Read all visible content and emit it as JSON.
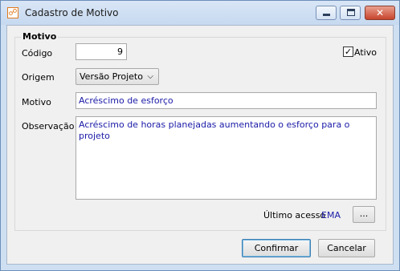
{
  "window": {
    "title": "Cadastro de Motivo",
    "controls": {
      "minimize_icon": "minimize-icon",
      "maximize_icon": "maximize-icon",
      "close_icon": "close-icon"
    }
  },
  "group": {
    "title": "Motivo"
  },
  "form": {
    "codigo_label": "Código",
    "codigo_value": "9",
    "ativo_label": "Ativo",
    "ativo_checked": true,
    "origem_label": "Origem",
    "origem_value": "Versão Projeto",
    "motivo_label": "Motivo",
    "motivo_value": "Acréscimo de esforço",
    "observacao_label": "Observação",
    "observacao_value": "Acréscimo de horas planejadas aumentando o esforço para o projeto",
    "ultimo_acesso_label": "Último acesso",
    "ultimo_acesso_value": "EMA",
    "browse_label": "..."
  },
  "buttons": {
    "confirm": "Confirmar",
    "cancel": "Cancelar"
  },
  "colors": {
    "value_text": "#1a1aa8",
    "titlebar": "#c6d9f0"
  }
}
